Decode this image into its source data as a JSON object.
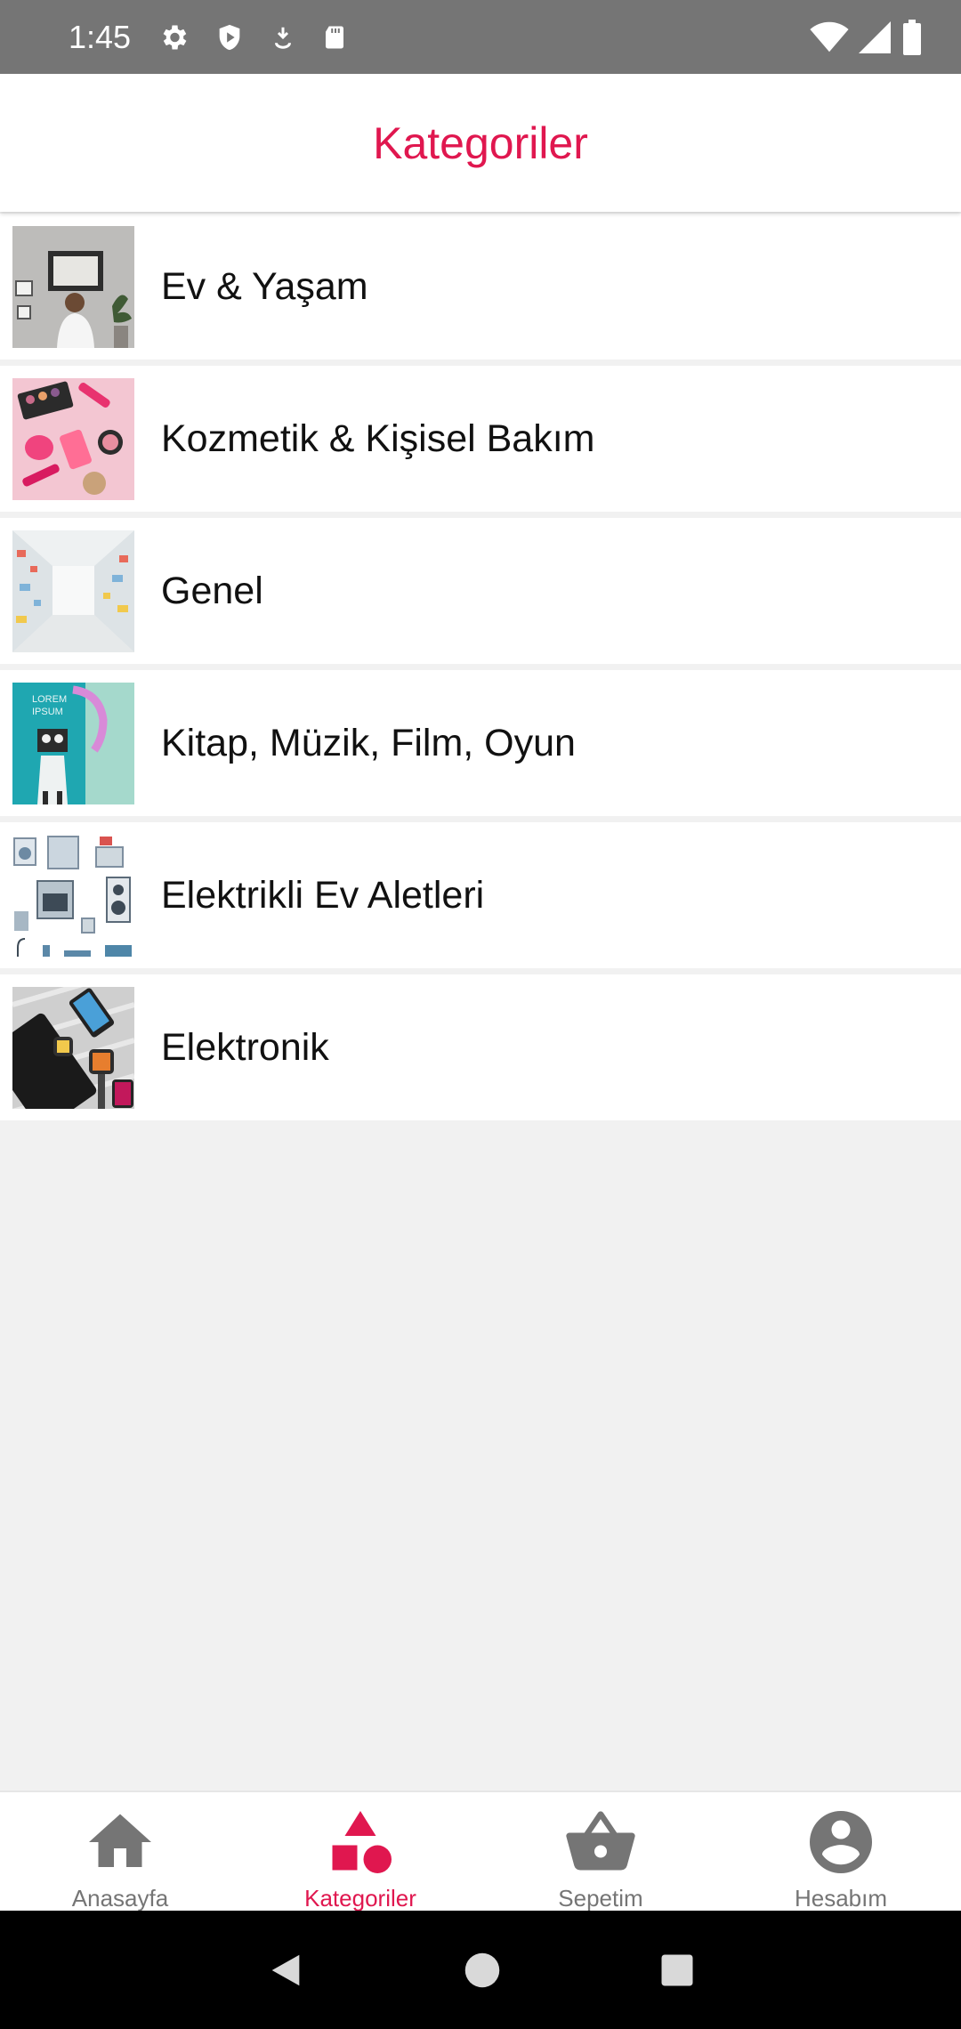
{
  "status_bar": {
    "time": "1:45",
    "left_icons": [
      "settings-icon",
      "shield-play-icon",
      "download-icon",
      "sd-card-icon"
    ],
    "right_icons": [
      "wifi-icon",
      "signal-icon",
      "battery-icon"
    ]
  },
  "header": {
    "title": "Kategoriler"
  },
  "categories": [
    {
      "label": "Ev & Yaşam",
      "image": "home-living-image"
    },
    {
      "label": "Kozmetik & Kişisel Bakım",
      "image": "cosmetics-image"
    },
    {
      "label": "Genel",
      "image": "store-aisle-image"
    },
    {
      "label": "Kitap, Müzik, Film, Oyun",
      "image": "book-music-image"
    },
    {
      "label": "Elektrikli Ev Aletleri",
      "image": "appliances-image"
    },
    {
      "label": "Elektronik",
      "image": "electronics-image"
    }
  ],
  "bottom_nav": {
    "active_tab": "Kategoriler",
    "accent_color": "#e0174f",
    "inactive_color": "#757575",
    "tabs": [
      {
        "label": "Anasayfa",
        "icon": "home-icon"
      },
      {
        "label": "Kategoriler",
        "icon": "shapes-icon"
      },
      {
        "label": "Sepetim",
        "icon": "basket-icon"
      },
      {
        "label": "Hesabım",
        "icon": "account-icon"
      }
    ]
  },
  "system_nav": {
    "buttons": [
      "back-icon",
      "home-circle-icon",
      "recents-icon"
    ]
  }
}
